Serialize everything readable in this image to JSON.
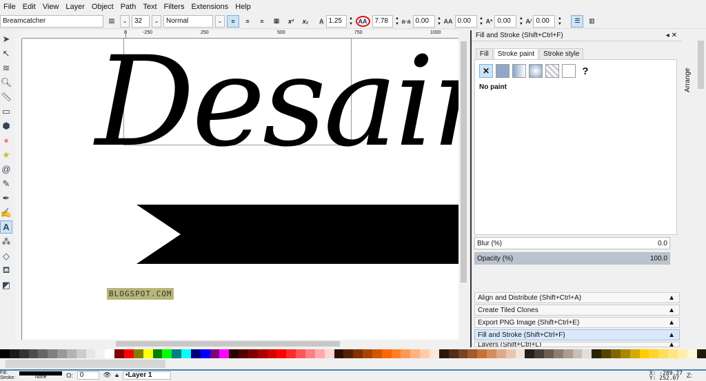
{
  "menu": [
    "File",
    "Edit",
    "View",
    "Layer",
    "Object",
    "Path",
    "Text",
    "Filters",
    "Extensions",
    "Help"
  ],
  "toolbar": {
    "font_family": "Breamcatcher",
    "font_size": "32",
    "font_style": "Normal",
    "line_spacing": "1.25",
    "letter_spacing": "7.78",
    "word_spacing": "0.00",
    "kerning": "0.00",
    "vertical_shift": "0.00",
    "rotation": "0.00",
    "superscript": "x²",
    "subscript": "x₂"
  },
  "ruler": {
    "top_ticks": [
      "-250",
      "0",
      "250",
      "500",
      "750",
      "1000"
    ]
  },
  "canvas": {
    "text": "DesainZ",
    "watermark": "BLOGSPOT.COM",
    "annotation_color": "#e01010"
  },
  "panel": {
    "title": "Fill and Stroke (Shift+Ctrl+F)",
    "tabs": [
      "Fill",
      "Stroke paint",
      "Stroke style"
    ],
    "active_tab": "Stroke paint",
    "paint_status": "No paint",
    "unknown_label": "?",
    "blur_label": "Blur (%)",
    "blur_value": "0.0",
    "opacity_label": "Opacity (%)",
    "opacity_value": "100.0",
    "side_tab": "Arrange",
    "docked": [
      "Align and Distribute (Shift+Ctrl+A)",
      "Create Tiled Clones",
      "Export PNG Image (Shift+Ctrl+E)",
      "Fill and Stroke (Shift+Ctrl+F)",
      "Layers (Shift+Ctrl+L)"
    ]
  },
  "palette": [
    "#000000",
    "#1a1a1a",
    "#333333",
    "#4d4d4d",
    "#666666",
    "#808080",
    "#999999",
    "#b3b3b3",
    "#cccccc",
    "#e6e6e6",
    "#f2f2f2",
    "#ffffff",
    "#800000",
    "#ff0000",
    "#808000",
    "#ffff00",
    "#008000",
    "#00ff00",
    "#008080",
    "#00ffff",
    "#000080",
    "#0000ff",
    "#800080",
    "#ff00ff",
    "#2b0000",
    "#550000",
    "#800000",
    "#aa0000",
    "#d40000",
    "#ff0000",
    "#ff2a2a",
    "#ff5555",
    "#ff8080",
    "#ffaaaa",
    "#ffd5d5",
    "#2b1100",
    "#552200",
    "#803300",
    "#aa4400",
    "#d45500",
    "#ff6600",
    "#ff7f2a",
    "#ff9955",
    "#ffb380",
    "#ffccaa",
    "#ffe6d5",
    "#28170b",
    "#502d16",
    "#784421",
    "#a05a2c",
    "#c87137",
    "#d38d5f",
    "#deaa87",
    "#e9c6af",
    "#f4e3d7",
    "#241f1c",
    "#483e37",
    "#6c5d53",
    "#917c6f",
    "#ac9d93",
    "#c8beb7",
    "#e3dedb",
    "#2b2200",
    "#554400",
    "#806600",
    "#aa8800",
    "#d4aa00",
    "#ffcc00",
    "#ffd42a",
    "#ffdd55",
    "#ffe680",
    "#ffeeaa",
    "#fff6d5",
    "#1e1b0b"
  ],
  "status": {
    "fill_label": "Fill:",
    "stroke_label": "Stroke:",
    "stroke_value": "None",
    "opacity_label": "O:",
    "opacity_value": "0",
    "layer": "•Layer 1",
    "x": "X: -289.27",
    "y": "Y: 252.07",
    "zoom_label": "Z:"
  }
}
